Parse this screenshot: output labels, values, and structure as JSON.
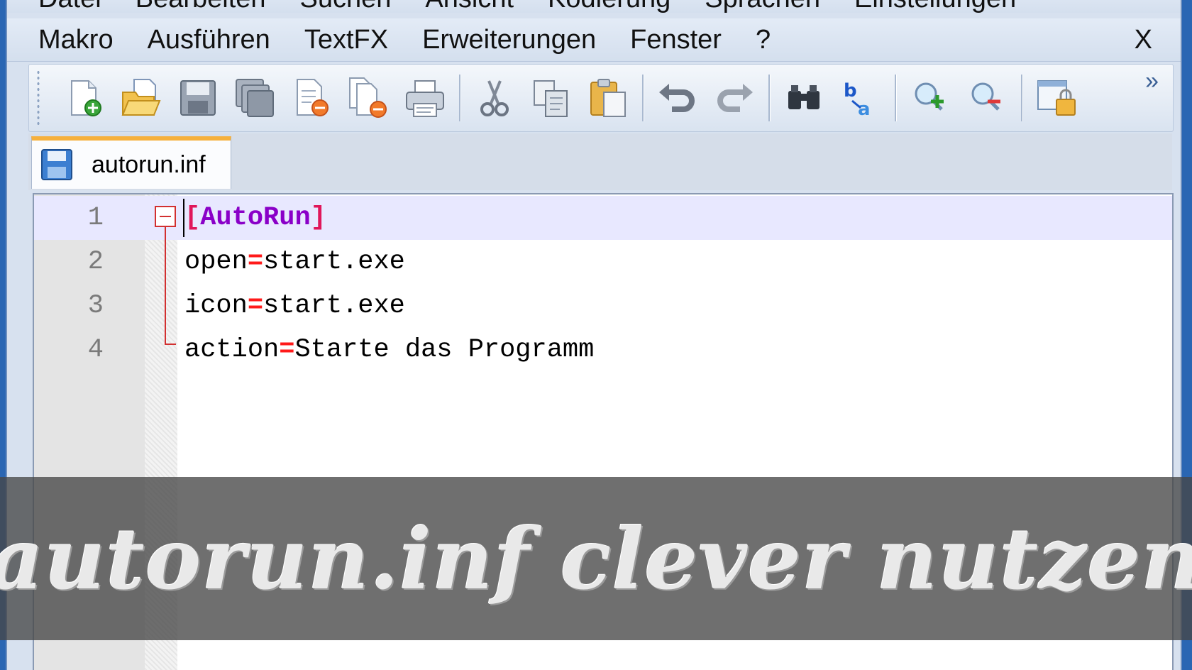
{
  "menus": {
    "top_row": [
      "Datei",
      "Bearbeiten",
      "Suchen",
      "Ansicht",
      "Kodierung",
      "Sprachen",
      "Einstellungen"
    ],
    "main_row": [
      "Makro",
      "Ausführen",
      "TextFX",
      "Erweiterungen",
      "Fenster",
      "?"
    ],
    "close_label": "X"
  },
  "toolbar": {
    "more_label": "»",
    "buttons": [
      "new-file-icon",
      "open-file-icon",
      "save-icon",
      "save-all-icon",
      "close-icon",
      "close-all-icon",
      "print-icon",
      "cut-icon",
      "copy-icon",
      "paste-icon",
      "undo-icon",
      "redo-icon",
      "find-icon",
      "replace-icon",
      "zoom-in-icon",
      "zoom-out-icon",
      "sync-view-icon"
    ]
  },
  "tab": {
    "label": "autorun.inf",
    "icon": "save-icon",
    "accent_color": "#f6b03c"
  },
  "editor": {
    "current_line": 1,
    "lines": [
      {
        "num": "1",
        "section": "AutoRun"
      },
      {
        "num": "2",
        "key": "open",
        "op": "=",
        "value": "start.exe"
      },
      {
        "num": "3",
        "key": "icon",
        "op": "=",
        "value": "start.exe"
      },
      {
        "num": "4",
        "key": "action",
        "op": "=",
        "value": "Starte das Programm"
      }
    ],
    "colors": {
      "section": "#8a00c8",
      "operator": "#ff1a1a",
      "fold": "#d23030"
    }
  },
  "banner": {
    "text": "autorun.inf clever nutzen"
  }
}
